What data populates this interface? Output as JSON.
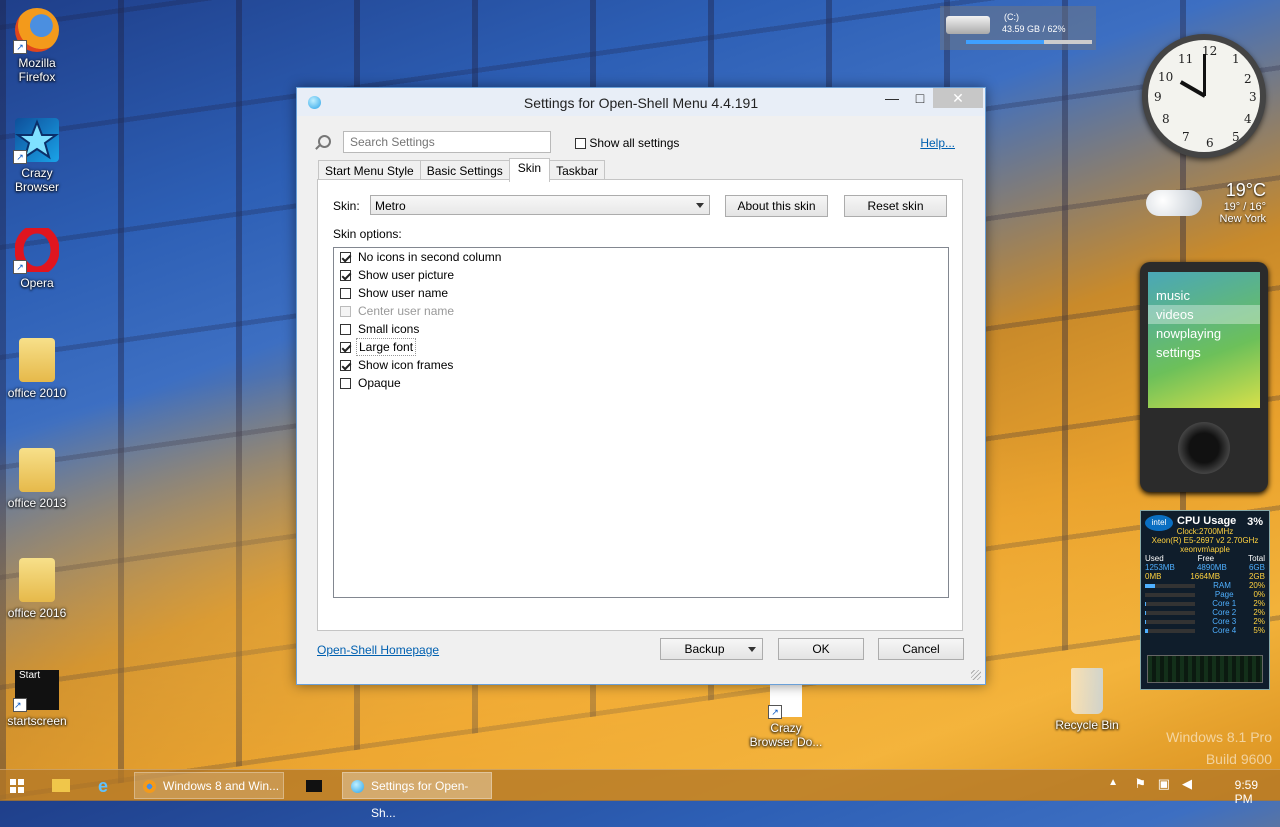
{
  "desktop": {
    "icons": [
      {
        "label_1": "Mozilla",
        "label_2": "Firefox",
        "icon": "firefox-icon"
      },
      {
        "label_1": "Crazy",
        "label_2": "Browser",
        "icon": "crazy-browser-icon"
      },
      {
        "label_1": "Opera",
        "icon": "opera-icon"
      },
      {
        "label_1": "office 2010",
        "icon": "folder-icon"
      },
      {
        "label_1": "office 2013",
        "icon": "folder-icon"
      },
      {
        "label_1": "office 2016",
        "icon": "folder-icon"
      },
      {
        "label_1": "startscreen",
        "tile_text": "Start",
        "icon": "startscreen-icon"
      },
      {
        "label_1": "Crazy",
        "label_2": "Browser Do...",
        "icon": "document-icon"
      },
      {
        "label_1": "Recycle Bin",
        "icon": "recycle-bin-icon"
      }
    ],
    "watermark": {
      "line1": "Windows 8.1 Pro",
      "line2": "Build 9600"
    }
  },
  "gadgets": {
    "drive": {
      "name": "(C:)",
      "usage": "43.59 GB / 62%",
      "fill_fraction": 0.62
    },
    "clock": {
      "hour": 10,
      "minute": 0
    },
    "weather": {
      "temp": "19°C",
      "range": "19° / 16°",
      "city": "New York"
    },
    "media": {
      "items": [
        "music",
        "videos",
        "nowplaying",
        "settings"
      ],
      "selected": "videos"
    },
    "cpu": {
      "brand": "intel",
      "title": "CPU Usage",
      "percent": "3%",
      "clock": "Clock:2700MHz",
      "model": "Xeon(R) E5-2697 v2 2.70GHz",
      "host": "xeonvm\\apple",
      "mem_headers": [
        "Used",
        "Free",
        "Total"
      ],
      "mem_row1": [
        "1253MB",
        "4890MB",
        "6GB"
      ],
      "mem_row2": [
        "0MB",
        "1664MB",
        "2GB"
      ],
      "bars": [
        {
          "name": "RAM",
          "value": "20%"
        },
        {
          "name": "Page",
          "value": "0%"
        },
        {
          "name": "Core 1",
          "value": "2%"
        },
        {
          "name": "Core 2",
          "value": "2%"
        },
        {
          "name": "Core 3",
          "value": "2%"
        },
        {
          "name": "Core 4",
          "value": "5%"
        }
      ]
    }
  },
  "window": {
    "title": "Settings for Open-Shell Menu 4.4.191",
    "controls": {
      "minimize": "—",
      "maximize": "□",
      "close": "✕"
    },
    "search_placeholder": "Search Settings",
    "show_all_label": "Show all settings",
    "show_all_checked": false,
    "help_label": "Help...",
    "tabs": [
      "Start Menu Style",
      "Basic Settings",
      "Skin",
      "Taskbar"
    ],
    "active_tab": "Skin",
    "skin_label": "Skin:",
    "skin_value": "Metro",
    "about_button": "About this skin",
    "reset_button": "Reset skin",
    "options_label": "Skin options:",
    "options": [
      {
        "label": "No icons in second column",
        "checked": true,
        "disabled": false
      },
      {
        "label": "Show user picture",
        "checked": true,
        "disabled": false
      },
      {
        "label": "Show user name",
        "checked": false,
        "disabled": false
      },
      {
        "label": "Center user name",
        "checked": false,
        "disabled": true
      },
      {
        "label": "Small icons",
        "checked": false,
        "disabled": false
      },
      {
        "label": "Large font",
        "checked": true,
        "disabled": false
      },
      {
        "label": "Show icon frames",
        "checked": true,
        "disabled": false
      },
      {
        "label": "Opaque",
        "checked": false,
        "disabled": false
      }
    ],
    "homepage_link": "Open-Shell Homepage",
    "backup_button": "Backup",
    "ok_button": "OK",
    "cancel_button": "Cancel"
  },
  "taskbar": {
    "tasks": [
      {
        "label": "Windows 8 and Win...",
        "icon": "firefox-icon"
      },
      {
        "label": "Settings for Open-Sh...",
        "icon": "open-shell-icon"
      }
    ],
    "time": "9:59 PM"
  }
}
